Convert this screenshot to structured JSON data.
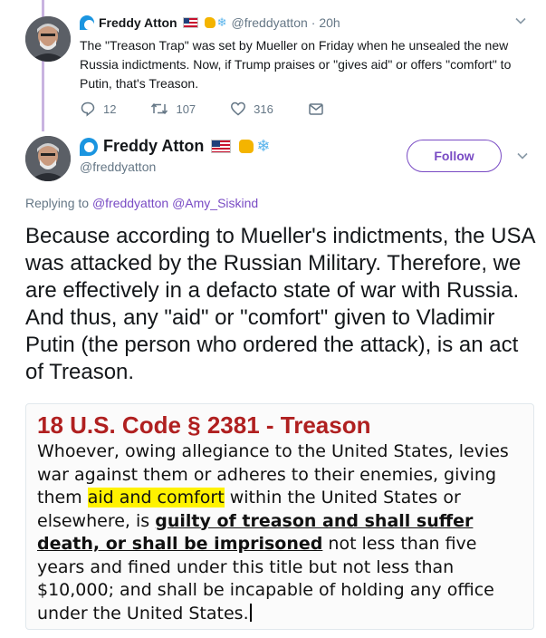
{
  "tweet1": {
    "name": "Freddy Atton",
    "handle": "@freddyatton",
    "time": "· 20h",
    "text": "The \"Treason Trap\" was set by Mueller on Friday when he unsealed the new Russia indictments. Now, if Trump praises or \"gives aid\" or offers \"comfort\" to Putin, that's Treason.",
    "actions": {
      "replies": "12",
      "retweets": "107",
      "likes": "316"
    }
  },
  "tweet2": {
    "name": "Freddy Atton",
    "handle": "@freddyatton",
    "follow_label": "Follow",
    "replying_prefix": "Replying to",
    "replying_to": [
      "@freddyatton",
      "@Amy_Siskind"
    ],
    "text": "Because according to Mueller's indictments, the USA was attacked by the Russian Military. Therefore, we are effectively in a defacto state of war with Russia. And thus, any \"aid\" or \"comfort\" given to Vladimir Putin (the person who ordered the attack), is an act of Treason."
  },
  "media": {
    "title": "18 U.S. Code § 2381 - Treason",
    "body_before": "Whoever, owing allegiance to the United States, levies war against them or adheres to their enemies, giving them ",
    "highlight": "aid and comfort",
    "body_middle": " within the United States or elsewhere, is ",
    "underlined": "guilty of treason and shall suffer death, or shall be imprisoned",
    "body_after": " not less than five years and fined under this title but not less than $10,000; and shall be incapable of holding any office under the United States."
  },
  "icons": {
    "caret": "chevron-down-icon",
    "reply": "reply-icon",
    "retweet": "retweet-icon",
    "like": "heart-icon",
    "dm": "message-icon",
    "snow": "❄"
  },
  "colors": {
    "accent": "#794bc4",
    "thread_line": "#c9b3e0",
    "secondary_text": "#657786",
    "law_title": "#b02020",
    "highlight": "#fff200"
  }
}
